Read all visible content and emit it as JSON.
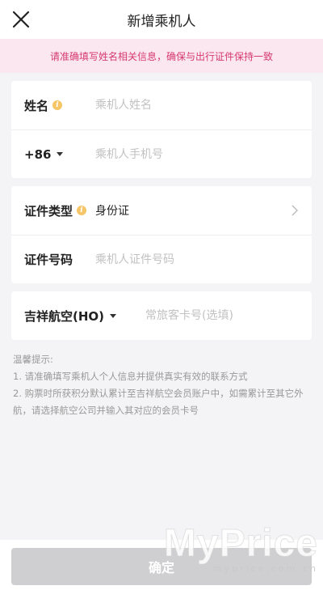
{
  "header": {
    "title": "新增乘机人",
    "close_icon": "close-icon"
  },
  "notice": {
    "text": "请准确填写姓名相关信息，确保与出行证件保持一致"
  },
  "form": {
    "name": {
      "label": "姓名",
      "info_icon": "i",
      "placeholder": "乘机人姓名"
    },
    "phone": {
      "country_code": "+86",
      "placeholder": "乘机人手机号"
    },
    "id_type": {
      "label": "证件类型",
      "info_icon": "i",
      "value": "身份证"
    },
    "id_number": {
      "label": "证件号码",
      "placeholder": "乘机人证件号码"
    },
    "frequent_flyer": {
      "airline": "吉祥航空(HO)",
      "placeholder": "常旅客卡号(选填)"
    }
  },
  "tips": {
    "title": "温馨提示:",
    "items": [
      "1. 请准确填写乘机人个人信息并提供真实有效的联系方式",
      "2. 购票时所获积分默认累计至吉祥航空会员账户中，如需累计至其它外航，请选择航空公司并输入其对应的会员卡号"
    ]
  },
  "footer": {
    "confirm_label": "确定"
  },
  "watermark": {
    "brand": "MyPrice",
    "domain": "myprice.com.cn"
  },
  "colors": {
    "notice_text": "#d6396f",
    "notice_bg": "#fbe7ef",
    "button_bg": "#cfcfd1",
    "info_icon": "#f6c567"
  }
}
